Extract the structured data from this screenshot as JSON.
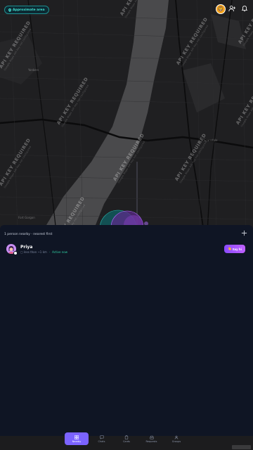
{
  "map": {
    "area_label": "Approximate area",
    "watermark_main": "API KEY REQUIRED",
    "watermark_sub": "Google Maps API key not configured",
    "places": [
      "Yonkers",
      "Scarsdale",
      "Fort Gorgon"
    ]
  },
  "header": {
    "avatar_emoji": "🦁"
  },
  "nearby": {
    "summary": "1 person nearby · nearest first",
    "people": [
      {
        "name": "Priya",
        "distance": "~1 km",
        "distance_text": "▢ less than",
        "status": "Active now",
        "action_label": "Say hi",
        "action_emoji": "👋"
      }
    ]
  },
  "nav": {
    "items": [
      {
        "label": "Nearby",
        "icon": "grid-icon",
        "active": true
      },
      {
        "label": "Chats",
        "icon": "chat-icon",
        "active": false
      },
      {
        "label": "Cards",
        "icon": "cards-icon",
        "active": false
      },
      {
        "label": "Requests",
        "icon": "inbox-icon",
        "active": false
      },
      {
        "label": "Groups",
        "icon": "groups-icon",
        "active": false
      }
    ]
  },
  "colors": {
    "accent": "#7b63ff",
    "teal": "#43e0d0",
    "online": "#2fd1a4",
    "sheet_bg": "#0f1524"
  }
}
